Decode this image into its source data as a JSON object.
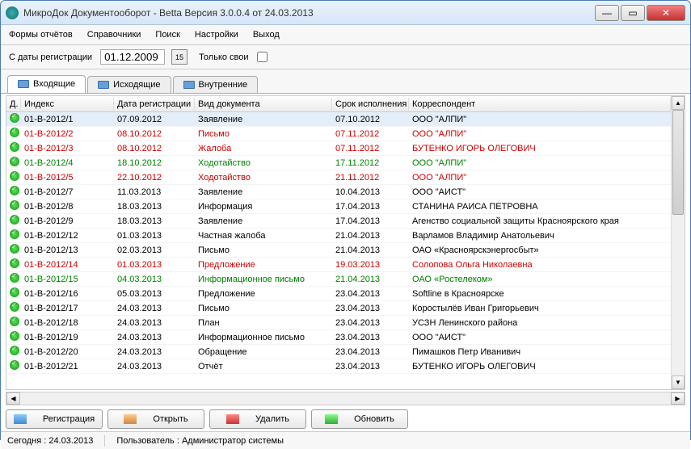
{
  "window": {
    "title": "МикроДок Документооборот - Betta Версия 3.0.0.4 от 24.03.2013"
  },
  "menu": {
    "items": [
      "Формы отчётов",
      "Справочники",
      "Поиск",
      "Настройки",
      "Выход"
    ]
  },
  "filter": {
    "date_label": "С даты регистрации",
    "date_value": "01.12.2009",
    "only_own_label": "Только свои"
  },
  "tabs": {
    "items": [
      "Входящие",
      "Исходящие",
      "Внутренние"
    ],
    "active": 0
  },
  "grid": {
    "headers": {
      "d": "Д.",
      "index": "Индекс",
      "regdate": "Дата регистрации",
      "doctype": "Вид документа",
      "deadline": "Срок исполнения",
      "corr": "Корреспондент"
    },
    "rows": [
      {
        "index": "01-В-2012/1",
        "regdate": "07.09.2012",
        "doctype": "Заявление",
        "deadline": "07.10.2012",
        "corr": "ООО \"АЛПИ\"",
        "color": "black",
        "selected": true
      },
      {
        "index": "01-В-2012/2",
        "regdate": "08.10.2012",
        "doctype": "Письмо",
        "deadline": "07.11.2012",
        "corr": "ООО \"АЛПИ\"",
        "color": "red"
      },
      {
        "index": "01-В-2012/3",
        "regdate": "08.10.2012",
        "doctype": "Жалоба",
        "deadline": "07.11.2012",
        "corr": "БУТЕНКО ИГОРЬ ОЛЕГОВИЧ",
        "color": "red"
      },
      {
        "index": "01-В-2012/4",
        "regdate": "18.10.2012",
        "doctype": "Ходотайство",
        "deadline": "17.11.2012",
        "corr": "ООО \"АЛПИ\"",
        "color": "green"
      },
      {
        "index": "01-В-2012/5",
        "regdate": "22.10.2012",
        "doctype": "Ходотайство",
        "deadline": "21.11.2012",
        "corr": "ООО \"АЛПИ\"",
        "color": "red"
      },
      {
        "index": "01-В-2012/7",
        "regdate": "11.03.2013",
        "doctype": "Заявление",
        "deadline": "10.04.2013",
        "corr": "ООО \"АИСТ\"",
        "color": "black"
      },
      {
        "index": "01-В-2012/8",
        "regdate": "18.03.2013",
        "doctype": "Информация",
        "deadline": "17.04.2013",
        "corr": "СТАНИНА РАИСА ПЕТРОВНА",
        "color": "black"
      },
      {
        "index": "01-В-2012/9",
        "regdate": "18.03.2013",
        "doctype": "Заявление",
        "deadline": "17.04.2013",
        "corr": "Агенство социальной защиты Красноярского края",
        "color": "black"
      },
      {
        "index": "01-В-2012/12",
        "regdate": "01.03.2013",
        "doctype": "Частная жалоба",
        "deadline": "21.04.2013",
        "corr": "Варламов Владимир Анатольевич",
        "color": "black"
      },
      {
        "index": "01-В-2012/13",
        "regdate": "02.03.2013",
        "doctype": "Письмо",
        "deadline": "21.04.2013",
        "corr": "ОАО «Красноярскэнергосбыт»",
        "color": "black"
      },
      {
        "index": "01-В-2012/14",
        "regdate": "01.03.2013",
        "doctype": "Предложение",
        "deadline": "19.03.2013",
        "corr": "Солопова Ольга Николаевна",
        "color": "red"
      },
      {
        "index": "01-В-2012/15",
        "regdate": "04.03.2013",
        "doctype": "Информационное письмо",
        "deadline": "21.04.2013",
        "corr": "ОАО «Ростелеком»",
        "color": "green"
      },
      {
        "index": "01-В-2012/16",
        "regdate": "05.03.2013",
        "doctype": "Предложение",
        "deadline": "23.04.2013",
        "corr": "Softline в Красноярске",
        "color": "black"
      },
      {
        "index": "01-В-2012/17",
        "regdate": "24.03.2013",
        "doctype": "Письмо",
        "deadline": "23.04.2013",
        "corr": "Коростылёв Иван Григорьевич",
        "color": "black"
      },
      {
        "index": "01-В-2012/18",
        "regdate": "24.03.2013",
        "doctype": "План",
        "deadline": "23.04.2013",
        "corr": "УСЗН Ленинского района",
        "color": "black"
      },
      {
        "index": "01-В-2012/19",
        "regdate": "24.03.2013",
        "doctype": "Информационное письмо",
        "deadline": "23.04.2013",
        "corr": "ООО \"АИСТ\"",
        "color": "black"
      },
      {
        "index": "01-В-2012/20",
        "regdate": "24.03.2013",
        "doctype": "Обращение",
        "deadline": "23.04.2013",
        "corr": "Пимашков Петр Иванивич",
        "color": "black"
      },
      {
        "index": "01-В-2012/21",
        "regdate": "24.03.2013",
        "doctype": "Отчёт",
        "deadline": "23.04.2013",
        "corr": "БУТЕНКО ИГОРЬ ОЛЕГОВИЧ",
        "color": "black"
      }
    ]
  },
  "actions": {
    "register": "Регистрация",
    "open": "Открыть",
    "delete": "Удалить",
    "refresh": "Обновить"
  },
  "status": {
    "today": "Сегодня : 24.03.2013",
    "user": "Пользователь : Администратор системы"
  }
}
